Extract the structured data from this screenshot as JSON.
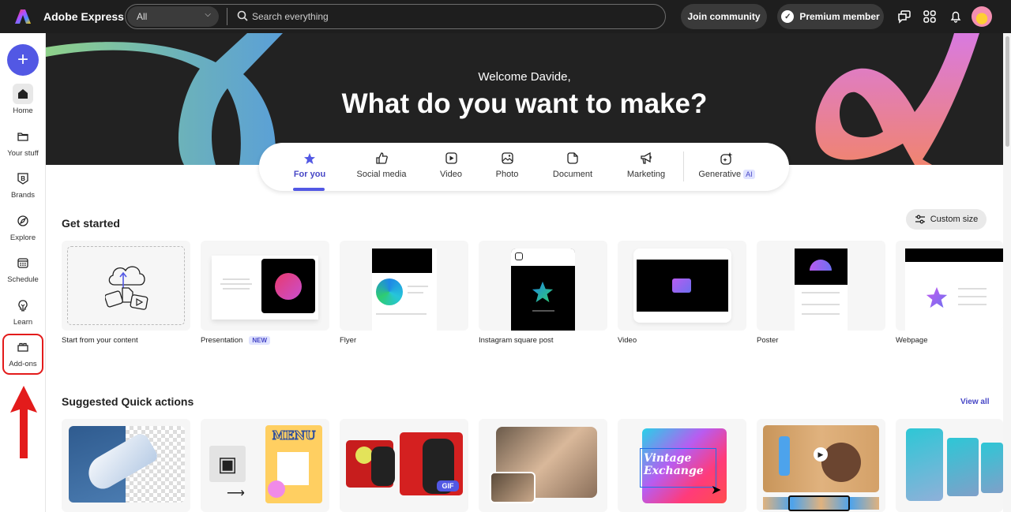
{
  "header": {
    "app_title": "Adobe Express",
    "search_scope": "All",
    "search_placeholder": "Search everything",
    "join_label": "Join community",
    "premium_label": "Premium member",
    "icons": [
      "chat-icon",
      "apps-grid-icon",
      "bell-icon",
      "avatar"
    ]
  },
  "sidebar": {
    "create_label": "+",
    "items": [
      {
        "label": "Home",
        "icon": "home-icon",
        "active": true
      },
      {
        "label": "Your stuff",
        "icon": "folder-icon"
      },
      {
        "label": "Brands",
        "icon": "brand-icon"
      },
      {
        "label": "Explore",
        "icon": "compass-icon"
      },
      {
        "label": "Schedule",
        "icon": "calendar-icon"
      },
      {
        "label": "Learn",
        "icon": "lightbulb-icon"
      },
      {
        "label": "Add-ons",
        "icon": "addons-icon",
        "highlighted": true
      }
    ]
  },
  "hero": {
    "welcome": "Welcome Davide,",
    "headline": "What do you want to make?",
    "tabs": [
      {
        "label": "For you",
        "icon": "star-icon",
        "active": true
      },
      {
        "label": "Social media",
        "icon": "thumbs-up-icon"
      },
      {
        "label": "Video",
        "icon": "video-play-icon"
      },
      {
        "label": "Photo",
        "icon": "photo-icon"
      },
      {
        "label": "Document",
        "icon": "document-icon"
      },
      {
        "label": "Marketing",
        "icon": "megaphone-icon"
      },
      {
        "label": "Generative",
        "icon": "sparkle-icon",
        "badge": "AI"
      }
    ]
  },
  "get_started": {
    "title": "Get started",
    "custom_size_label": "Custom size",
    "cards": [
      {
        "label": "Start from your content"
      },
      {
        "label": "Presentation",
        "badge": "NEW"
      },
      {
        "label": "Flyer"
      },
      {
        "label": "Instagram square post"
      },
      {
        "label": "Video"
      },
      {
        "label": "Poster"
      },
      {
        "label": "Webpage"
      }
    ]
  },
  "quick_actions": {
    "title": "Suggested Quick actions",
    "view_all_label": "View all",
    "cards": [
      {
        "name": "remove-background"
      },
      {
        "name": "qr-code-menu",
        "text": "MENU"
      },
      {
        "name": "convert-to-gif",
        "text": "GIF"
      },
      {
        "name": "crop-image"
      },
      {
        "name": "edit-text",
        "text": "Vintage Exchange"
      },
      {
        "name": "trim-video"
      },
      {
        "name": "resize-video"
      }
    ]
  },
  "colors": {
    "accent": "#5258e4",
    "topbar": "#1e1e1e",
    "hero_bg": "#222222",
    "annotation": "#e31b1b"
  }
}
